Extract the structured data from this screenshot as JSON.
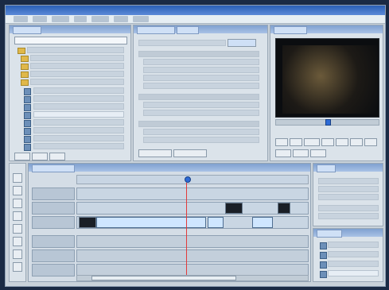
{
  "app": {
    "title": ""
  },
  "menu": {
    "items": [
      "",
      "",
      "",
      "",
      "",
      "",
      ""
    ]
  },
  "project_panel": {
    "tabs": [
      ""
    ],
    "search_value": ""
  },
  "effect_controls_panel": {
    "tabs": [
      ""
    ]
  },
  "program_monitor": {
    "timecode": ""
  },
  "timeline": {
    "tabs": [
      ""
    ]
  },
  "info_panel": {
    "tabs": [
      ""
    ]
  },
  "history_panel": {
    "tabs": [
      ""
    ]
  }
}
